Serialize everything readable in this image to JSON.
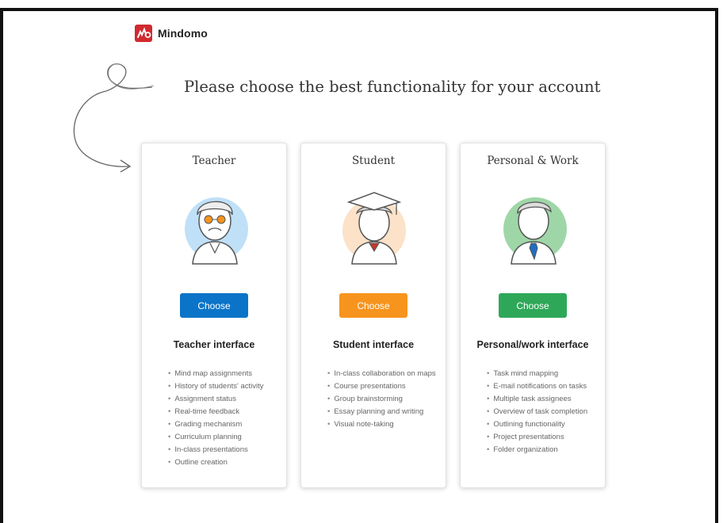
{
  "app": {
    "name": "Mindomo"
  },
  "headline": "Please choose the best functionality for your account",
  "colors": {
    "teacher": "#0b74c8",
    "student": "#f7941d",
    "personal": "#2ea858",
    "brand": "#d12a2f"
  },
  "cards": [
    {
      "title": "Teacher",
      "button": "Choose",
      "interface": "Teacher interface",
      "features": [
        "Mind map assignments",
        "History of students' activity",
        "Assignment status",
        "Real-time feedback",
        "Grading mechanism",
        "Curriculum planning",
        "In-class presentations",
        "Outline creation"
      ]
    },
    {
      "title": "Student",
      "button": "Choose",
      "interface": "Student interface",
      "features": [
        "In-class collaboration on maps",
        "Course presentations",
        "Group brainstorming",
        "Essay planning and writing",
        "Visual note-taking"
      ]
    },
    {
      "title": "Personal & Work",
      "button": "Choose",
      "interface": "Personal/work interface",
      "features": [
        "Task mind mapping",
        "E-mail notifications on tasks",
        "Multiple task assignees",
        "Overview of task completion",
        "Outlining functionality",
        "Project presentations",
        "Folder organization"
      ]
    }
  ]
}
